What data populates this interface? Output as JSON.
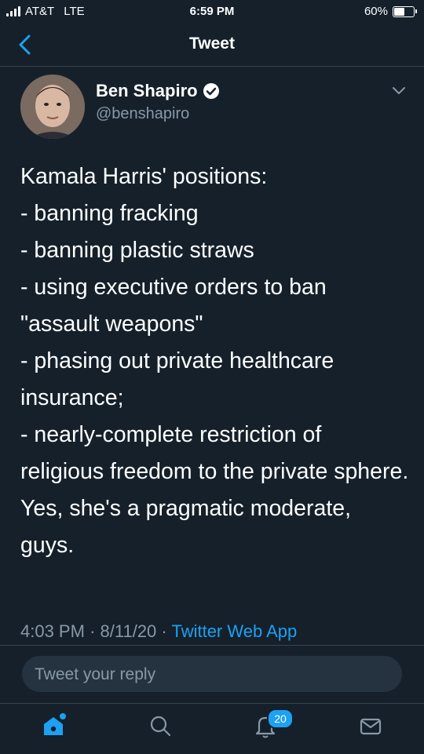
{
  "status_bar": {
    "carrier": "AT&T",
    "network": "LTE",
    "time": "6:59 PM",
    "battery": "60%",
    "battery_level": 0.6
  },
  "nav": {
    "back_icon": "chevron-left-icon",
    "title": "Tweet"
  },
  "author": {
    "name": "Ben Shapiro",
    "verified": true,
    "handle": "@benshapiro"
  },
  "tweet": {
    "text": "Kamala Harris' positions:\n- banning fracking\n- banning plastic straws\n- using executive orders to ban \"assault weapons\"\n- phasing out private healthcare insurance;\n- nearly-complete restriction of religious freedom to the private sphere.\nYes, she's a pragmatic moderate, guys.",
    "time": "4:03 PM",
    "date": "8/11/20",
    "source": "Twitter Web App"
  },
  "reply": {
    "placeholder": "Tweet your reply"
  },
  "tabbar": {
    "items": [
      "home-icon",
      "search-icon",
      "notifications-icon",
      "messages-icon"
    ],
    "notifications_badge": "20"
  },
  "colors": {
    "background": "#15202b",
    "accent": "#1da1f2",
    "muted": "#8899a6",
    "divider": "#38444d"
  }
}
